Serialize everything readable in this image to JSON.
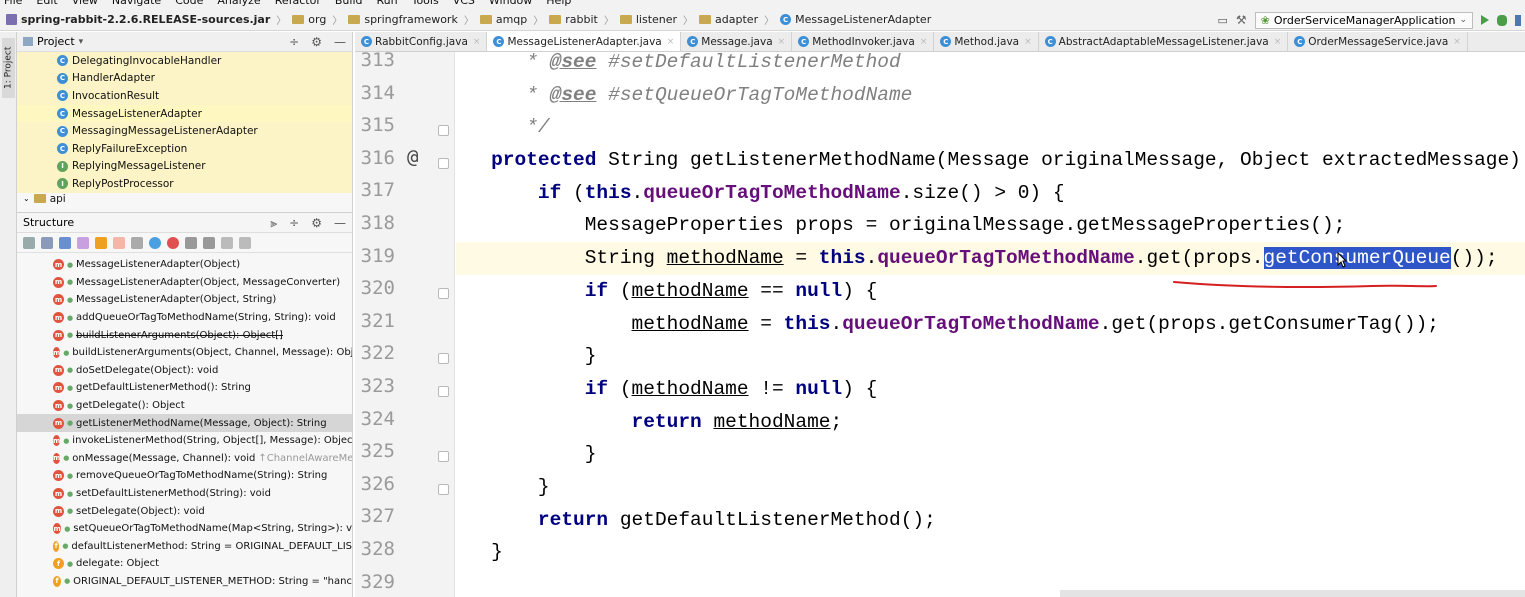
{
  "menubar": {
    "items": [
      "File",
      "Edit",
      "View",
      "Navigate",
      "Code",
      "Analyze",
      "Refactor",
      "Build",
      "Run",
      "Tools",
      "VCS",
      "Window",
      "Help"
    ]
  },
  "navbar": {
    "crumbs": [
      "spring-rabbit-2.2.6.RELEASE-sources.jar",
      "org",
      "springframework",
      "amqp",
      "rabbit",
      "listener",
      "adapter",
      "MessageListenerAdapter"
    ],
    "run_config": "OrderServiceManagerApplication"
  },
  "left_strip": {
    "tab_label": "1: Project"
  },
  "project_panel": {
    "title": "Project",
    "items": [
      {
        "icon": "class-icon",
        "label": "DelegatingInvocableHandler"
      },
      {
        "icon": "class-icon",
        "label": "HandlerAdapter"
      },
      {
        "icon": "class-icon",
        "label": "InvocationResult"
      },
      {
        "icon": "class-icon",
        "label": "MessageListenerAdapter"
      },
      {
        "icon": "class-icon",
        "label": "MessagingMessageListenerAdapter"
      },
      {
        "icon": "class-icon",
        "label": "ReplyFailureException"
      },
      {
        "icon": "interface-icon",
        "label": "ReplyingMessageListener"
      },
      {
        "icon": "interface-icon",
        "label": "ReplyPostProcessor"
      }
    ],
    "last_folder": "api"
  },
  "structure_panel": {
    "title": "Structure",
    "items": [
      {
        "kind": "m",
        "label": "MessageListenerAdapter(Object)",
        "deprecated": false
      },
      {
        "kind": "m",
        "label": "MessageListenerAdapter(Object, MessageConverter)",
        "deprecated": false
      },
      {
        "kind": "m",
        "label": "MessageListenerAdapter(Object, String)",
        "deprecated": false
      },
      {
        "kind": "m",
        "label": "addQueueOrTagToMethodName(String, String): void",
        "deprecated": false
      },
      {
        "kind": "m",
        "label": "buildListenerArguments(Object): Object[]",
        "deprecated": true
      },
      {
        "kind": "m",
        "label": "buildListenerArguments(Object, Channel, Message): Obj",
        "deprecated": false
      },
      {
        "kind": "m",
        "label": "doSetDelegate(Object): void",
        "deprecated": false
      },
      {
        "kind": "m",
        "label": "getDefaultListenerMethod(): String",
        "deprecated": false
      },
      {
        "kind": "m",
        "label": "getDelegate(): Object",
        "deprecated": false
      },
      {
        "kind": "m",
        "label": "getListenerMethodName(Message, Object): String",
        "deprecated": false,
        "selected": true
      },
      {
        "kind": "m",
        "label": "invokeListenerMethod(String, Object[], Message): Objec",
        "deprecated": false
      },
      {
        "kind": "m",
        "label": "onMessage(Message, Channel): void",
        "suffix": "↑ChannelAwareMe",
        "deprecated": false
      },
      {
        "kind": "m",
        "label": "removeQueueOrTagToMethodName(String): String",
        "deprecated": false
      },
      {
        "kind": "m",
        "label": "setDefaultListenerMethod(String): void",
        "deprecated": false
      },
      {
        "kind": "m",
        "label": "setDelegate(Object): void",
        "deprecated": false
      },
      {
        "kind": "m",
        "label": "setQueueOrTagToMethodName(Map<String, String>): v",
        "deprecated": false
      },
      {
        "kind": "f",
        "label": "defaultListenerMethod: String = ORIGINAL_DEFAULT_LIS",
        "deprecated": false
      },
      {
        "kind": "f",
        "label": "delegate: Object",
        "deprecated": false
      },
      {
        "kind": "f",
        "label": "ORIGINAL_DEFAULT_LISTENER_METHOD: String = \"hanc",
        "deprecated": false
      }
    ]
  },
  "tabs": [
    {
      "label": "RabbitConfig.java",
      "active": false
    },
    {
      "label": "MessageListenerAdapter.java",
      "active": true
    },
    {
      "label": "Message.java",
      "active": false
    },
    {
      "label": "MethodInvoker.java",
      "active": false
    },
    {
      "label": "Method.java",
      "active": false
    },
    {
      "label": "AbstractAdaptableMessageListener.java",
      "active": false
    },
    {
      "label": "OrderMessageService.java",
      "active": false
    }
  ],
  "editor": {
    "line_numbers": [
      "313",
      "314",
      "315",
      "316",
      "317",
      "318",
      "319",
      "320",
      "321",
      "322",
      "323",
      "324",
      "325",
      "326",
      "327",
      "328",
      "329"
    ],
    "current_line": "319",
    "selection_text": "getConsumerQueue",
    "code": {
      "l313_tag": "@see",
      "l313_rest": " #setDefaultListenerMethod",
      "l314_tag": "@see",
      "l314_rest": " #setQueueOrTagToMethodName",
      "l315": "*/",
      "l316_kw": "protected",
      "l316_rest": " String getListenerMethodName(Message originalMessage, Object extractedMessage) {",
      "l317_kw1": "if",
      "l317_a": " (",
      "l317_kw2": "this",
      "l317_b": ".",
      "l317_fld": "queueOrTagToMethodName",
      "l317_c": ".size() > 0) {",
      "l318": "MessageProperties props = originalMessage.getMessageProperties();",
      "l319_a": "String ",
      "l319_var": "methodName",
      "l319_b": " = ",
      "l319_kw": "this",
      "l319_c": ".",
      "l319_fld": "queueOrTagToMethodName",
      "l319_d": ".get(props.",
      "l319_e": "());",
      "l320_kw": "if",
      "l320_a": " (",
      "l320_var": "methodName",
      "l320_b": " == ",
      "l320_kw2": "null",
      "l320_c": ") {",
      "l321_var": "methodName",
      "l321_a": " = ",
      "l321_kw": "this",
      "l321_b": ".",
      "l321_fld": "queueOrTagToMethodName",
      "l321_c": ".get(props.getConsumerTag());",
      "l322": "}",
      "l323_kw": "if",
      "l323_a": " (",
      "l323_var": "methodName",
      "l323_b": " != ",
      "l323_kw2": "null",
      "l323_c": ") {",
      "l324_kw": "return",
      "l324_a": " ",
      "l324_var": "methodName",
      "l324_b": ";",
      "l325": "}",
      "l326": "}",
      "l327_kw": "return",
      "l327_a": " getDefaultListenerMethod();",
      "l328": "}"
    }
  },
  "colors": {
    "keyword": "#000080",
    "field": "#660e7a",
    "comment": "#808080",
    "selection": "#2f56c9",
    "annotation_red": "#d62020"
  }
}
